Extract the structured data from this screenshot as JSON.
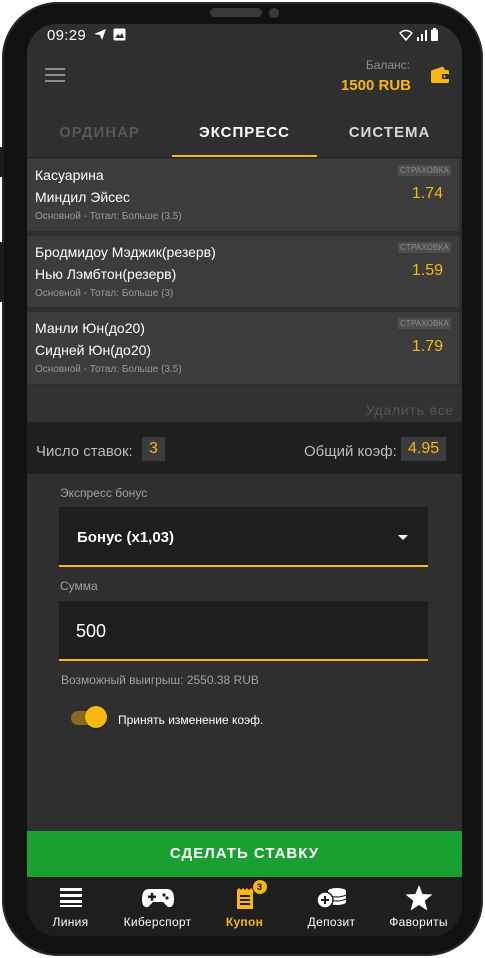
{
  "status_bar": {
    "time": "09:29"
  },
  "header": {
    "balance_label": "Баланс:",
    "balance_value": "1500 RUB",
    "menu_icon": "hamburger-icon",
    "wallet_icon": "wallet-icon"
  },
  "tabs": [
    {
      "label": "ОРДИНАР",
      "state": "inactive"
    },
    {
      "label": "ЭКСПРЕСС",
      "state": "active"
    },
    {
      "label": "СИСТЕМА",
      "state": "inactive"
    }
  ],
  "bets": [
    {
      "team1": "Касуарина",
      "team2": "Миндил Эйсес",
      "market": "Основной - Тотал: Больше (3.5)",
      "insurance": "СТРАХОВКА",
      "coef": "1.74"
    },
    {
      "team1": "Бродмидоу Мэджик(резерв)",
      "team2": "Нью Лэмбтон(резерв)",
      "market": "Основной - Тотал: Больше (3)",
      "insurance": "СТРАХОВКА",
      "coef": "1.59"
    },
    {
      "team1": "Манли Юн(до20)",
      "team2": "Сидней Юн(до20)",
      "market": "Основной - Тотал: Больше (3.5)",
      "insurance": "СТРАХОВКА",
      "coef": "1.79"
    }
  ],
  "delete_all": "Удалить все",
  "summary": {
    "bets_count_label": "Число ставок:",
    "bets_count": "3",
    "total_coef_label": "Общий коэф:",
    "total_coef": "4.95"
  },
  "express_bonus": {
    "label": "Экспресс бонус",
    "selected": "Бонус (x1,03)"
  },
  "amount": {
    "label": "Сумма",
    "value": "500"
  },
  "possible_win": "Возможный выигрыш: 2550.38 RUB",
  "accept_changes": {
    "label": "Принять изменение коэф.",
    "on": true
  },
  "make_bet_button": "СДЕЛАТЬ СТАВКУ",
  "bottom_nav": [
    {
      "label": "Линия",
      "icon": "list-icon"
    },
    {
      "label": "Киберспорт",
      "icon": "gamepad-icon"
    },
    {
      "label": "Купон",
      "icon": "coupon-icon",
      "badge": "3",
      "active": true
    },
    {
      "label": "Депозит",
      "icon": "coins-icon"
    },
    {
      "label": "Фавориты",
      "icon": "star-icon"
    }
  ],
  "colors": {
    "accent": "#f9b70f",
    "button_green": "#1aa030",
    "background": "#2f2f2f"
  }
}
